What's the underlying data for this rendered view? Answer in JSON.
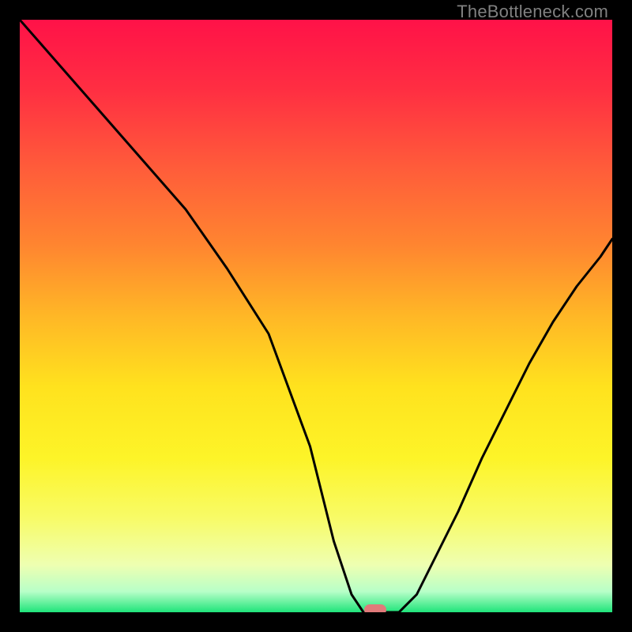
{
  "watermark": "TheBottleneck.com",
  "chart_data": {
    "type": "line",
    "title": "",
    "xlabel": "",
    "ylabel": "",
    "xlim": [
      0,
      100
    ],
    "ylim": [
      0,
      100
    ],
    "grid": false,
    "series": [
      {
        "name": "bottleneck-curve",
        "x": [
          0,
          7,
          14,
          21,
          28,
          35,
          42,
          49,
          53,
          56,
          58,
          61,
          64,
          67,
          70,
          74,
          78,
          82,
          86,
          90,
          94,
          98,
          100
        ],
        "y": [
          100,
          92,
          84,
          76,
          68,
          58,
          47,
          28,
          12,
          3,
          0,
          0,
          0,
          3,
          9,
          17,
          26,
          34,
          42,
          49,
          55,
          60,
          63
        ]
      }
    ],
    "marker": {
      "x": 60,
      "y": 0,
      "color": "#e07a7a"
    },
    "background_gradient": {
      "stops": [
        {
          "offset": 0.0,
          "color": "#ff1248"
        },
        {
          "offset": 0.12,
          "color": "#ff2f42"
        },
        {
          "offset": 0.25,
          "color": "#ff5c3a"
        },
        {
          "offset": 0.38,
          "color": "#ff8530"
        },
        {
          "offset": 0.5,
          "color": "#ffb726"
        },
        {
          "offset": 0.62,
          "color": "#ffe21e"
        },
        {
          "offset": 0.74,
          "color": "#fdf428"
        },
        {
          "offset": 0.84,
          "color": "#f8fb66"
        },
        {
          "offset": 0.92,
          "color": "#eeffb1"
        },
        {
          "offset": 0.965,
          "color": "#b8ffc8"
        },
        {
          "offset": 1.0,
          "color": "#1fe47a"
        }
      ]
    }
  }
}
